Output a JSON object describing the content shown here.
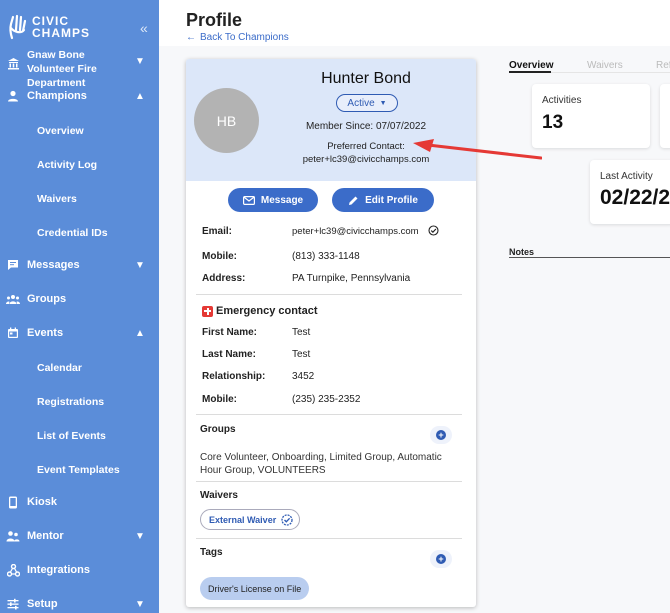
{
  "sidebar": {
    "logo_line1": "CIVIC",
    "logo_line2": "CHAMPS",
    "collapse_icon": "«",
    "org_name": "Gnaw Bone Volunteer Fire Department",
    "items": {
      "champions": "Champions",
      "overview": "Overview",
      "activity_log": "Activity Log",
      "waivers": "Waivers",
      "credential_ids": "Credential IDs",
      "messages": "Messages",
      "groups": "Groups",
      "events": "Events",
      "calendar": "Calendar",
      "registrations": "Registrations",
      "list_of_events": "List of Events",
      "event_templates": "Event Templates",
      "kiosk": "Kiosk",
      "mentor": "Mentor",
      "integrations": "Integrations",
      "setup": "Setup"
    }
  },
  "header": {
    "title": "Profile",
    "back": "Back To Champions"
  },
  "profile": {
    "initials": "HB",
    "name": "Hunter Bond",
    "status": "Active",
    "member_since": "Member Since: 07/07/2022",
    "preferred_contact_label": "Preferred Contact:",
    "preferred_contact_value": "peter+lc39@civicchamps.com",
    "message_btn": "Message",
    "edit_btn": "Edit Profile",
    "fields": {
      "email_label": "Email:",
      "email": "peter+lc39@civicchamps.com",
      "mobile_label": "Mobile:",
      "mobile": "(813) 333-1148",
      "address_label": "Address:",
      "address": "PA Turnpike, Pennsylvania"
    },
    "emergency": {
      "title": "Emergency contact",
      "first_name_label": "First Name:",
      "first_name": "Test",
      "last_name_label": "Last Name:",
      "last_name": "Test",
      "relationship_label": "Relationship:",
      "relationship": "3452",
      "mobile_label": "Mobile:",
      "mobile": "(235) 235-2352"
    },
    "groups_title": "Groups",
    "groups_value": "Core Volunteer, Onboarding, Limited Group, Automatic Hour Group, VOLUNTEERS",
    "waivers_title": "Waivers",
    "waiver_chip": "External Waiver",
    "tags_title": "Tags",
    "tag_chip": "Driver's License on File"
  },
  "tabs": {
    "overview": "Overview",
    "waivers": "Waivers",
    "ref": "Ref"
  },
  "stats": {
    "activities_label": "Activities",
    "activities_value": "13",
    "last_activity_label": "Last Activity",
    "last_activity_value": "02/22/2"
  },
  "notes_label": "Notes",
  "colors": {
    "sidebar": "#5b8dd9",
    "primary": "#3b6cc9",
    "header_band": "#dce7f9",
    "annotation_arrow": "#e53935"
  }
}
